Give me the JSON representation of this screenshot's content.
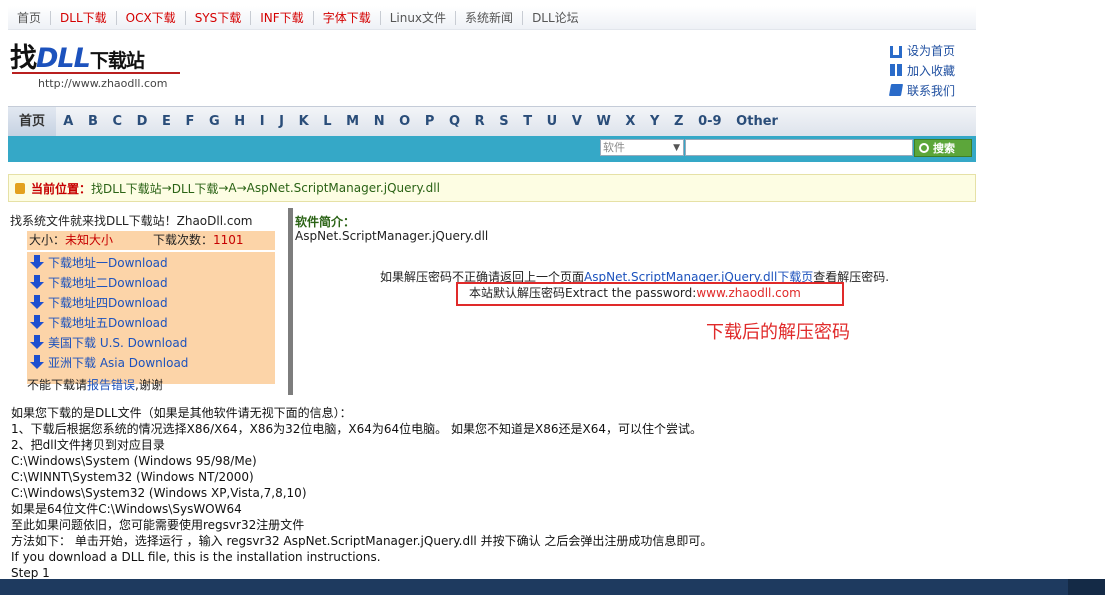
{
  "top_nav": [
    {
      "label": "首页",
      "color": "gray"
    },
    {
      "label": "DLL下载",
      "color": "red"
    },
    {
      "label": "OCX下载",
      "color": "red"
    },
    {
      "label": "SYS下载",
      "color": "red"
    },
    {
      "label": "INF下载",
      "color": "red"
    },
    {
      "label": "字体下载",
      "color": "red"
    },
    {
      "label": "Linux文件",
      "color": "gray"
    },
    {
      "label": "系统新闻",
      "color": "gray"
    },
    {
      "label": "DLL论坛",
      "color": "gray"
    }
  ],
  "logo": {
    "part1": "找",
    "part2": "DLL",
    "part3": "下载站",
    "url": "http://www.zhaodll.com"
  },
  "quick_links": [
    {
      "label": "设为首页",
      "icon": "home-icon"
    },
    {
      "label": "加入收藏",
      "icon": "favorite-icon"
    },
    {
      "label": "联系我们",
      "icon": "contact-icon"
    }
  ],
  "letter_nav": {
    "home": "首页",
    "letters": [
      "A",
      "B",
      "C",
      "D",
      "E",
      "F",
      "G",
      "H",
      "I",
      "J",
      "K",
      "L",
      "M",
      "N",
      "O",
      "P",
      "Q",
      "R",
      "S",
      "T",
      "U",
      "V",
      "W",
      "X",
      "Y",
      "Z",
      "0-9",
      "Other"
    ]
  },
  "search": {
    "category": "软件",
    "button": "搜索"
  },
  "breadcrumb": {
    "label": "当前位置：",
    "parts": [
      "找DLL下载站",
      " → ",
      "DLL下载",
      " → ",
      "A",
      " → ",
      "AspNet.ScriptManager.jQuery.dll"
    ]
  },
  "left_box": {
    "intro": "找系统文件就来找DLL下载站！ZhaoDll.com",
    "size_label": "大小：",
    "size_value": "未知大小",
    "count_label": "下载次数：",
    "count_value": "1101",
    "downloads": [
      "下载地址一Download",
      "下载地址二Download",
      "下载地址四Download",
      "下载地址五Download",
      "美国下载 U.S. Download",
      "亚洲下载 Asia Download"
    ],
    "report_prefix": "不能下载请",
    "report_link": "报告错误",
    "report_suffix": ",谢谢"
  },
  "software": {
    "heading": "软件简介：",
    "name": "AspNet.ScriptManager.jQuery.dll",
    "note_prefix": "如果解压密码不正确请返回上一个页面",
    "note_link": "AspNet.ScriptManager.jQuery.dll下载页",
    "note_suffix": "查看解压密码.",
    "pw_prefix": "本站默认解压密码Extract the password:",
    "pw_value": "www.zhaodll.com",
    "annotation": "下载后的解压密码"
  },
  "instructions": [
    "如果您下载的是DLL文件（如果是其他软件请无视下面的信息）：",
    "1、下载后根据您系统的情况选择X86/X64，X86为32位电脑，X64为64位电脑。 如果您不知道是X86还是X64，可以住个尝试。",
    "2、把dll文件拷贝到对应目录",
    "C:\\Windows\\System (Windows 95/98/Me)",
    "C:\\WINNT\\System32 (Windows NT/2000)",
    "C:\\Windows\\System32 (Windows XP,Vista,7,8,10)",
    "如果是64位文件C:\\Windows\\SysWOW64",
    "至此如果问题依旧，您可能需要使用regsvr32注册文件",
    "方法如下： 单击开始，选择运行 ，输入 regsvr32 AspNet.ScriptManager.jQuery.dll 并按下确认 之后会弹出注册成功信息即可。",
    "If you download a DLL file, this is the installation instructions.",
    "Step 1"
  ],
  "colors": {
    "search_bar": "#35a8c7",
    "accent_red": "#e02a2a",
    "link_blue": "#1c52bd",
    "download_panel": "#fcd4a8"
  }
}
